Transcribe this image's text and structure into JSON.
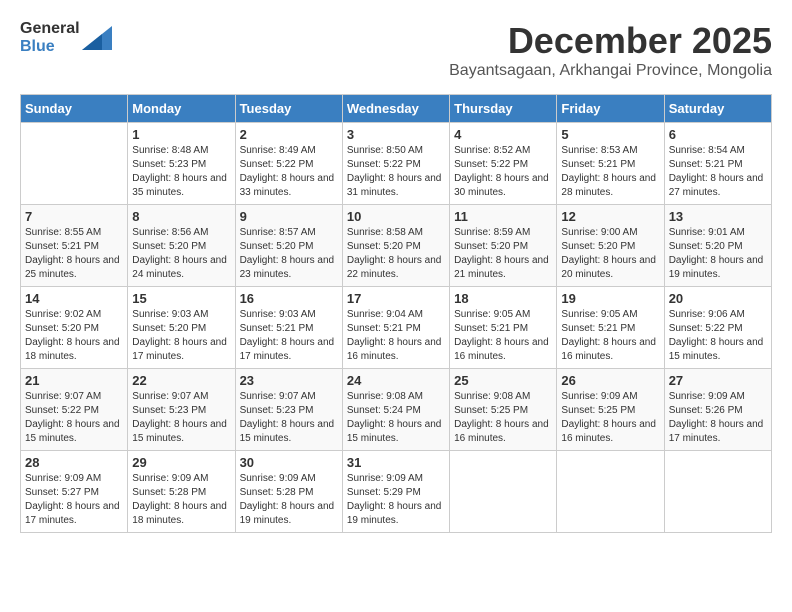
{
  "header": {
    "logo_general": "General",
    "logo_blue": "Blue",
    "month_title": "December 2025",
    "subtitle": "Bayantsagaan, Arkhangai Province, Mongolia"
  },
  "days_of_week": [
    "Sunday",
    "Monday",
    "Tuesday",
    "Wednesday",
    "Thursday",
    "Friday",
    "Saturday"
  ],
  "weeks": [
    [
      {
        "day": "",
        "sunrise": "",
        "sunset": "",
        "daylight": ""
      },
      {
        "day": "1",
        "sunrise": "Sunrise: 8:48 AM",
        "sunset": "Sunset: 5:23 PM",
        "daylight": "Daylight: 8 hours and 35 minutes."
      },
      {
        "day": "2",
        "sunrise": "Sunrise: 8:49 AM",
        "sunset": "Sunset: 5:22 PM",
        "daylight": "Daylight: 8 hours and 33 minutes."
      },
      {
        "day": "3",
        "sunrise": "Sunrise: 8:50 AM",
        "sunset": "Sunset: 5:22 PM",
        "daylight": "Daylight: 8 hours and 31 minutes."
      },
      {
        "day": "4",
        "sunrise": "Sunrise: 8:52 AM",
        "sunset": "Sunset: 5:22 PM",
        "daylight": "Daylight: 8 hours and 30 minutes."
      },
      {
        "day": "5",
        "sunrise": "Sunrise: 8:53 AM",
        "sunset": "Sunset: 5:21 PM",
        "daylight": "Daylight: 8 hours and 28 minutes."
      },
      {
        "day": "6",
        "sunrise": "Sunrise: 8:54 AM",
        "sunset": "Sunset: 5:21 PM",
        "daylight": "Daylight: 8 hours and 27 minutes."
      }
    ],
    [
      {
        "day": "7",
        "sunrise": "Sunrise: 8:55 AM",
        "sunset": "Sunset: 5:21 PM",
        "daylight": "Daylight: 8 hours and 25 minutes."
      },
      {
        "day": "8",
        "sunrise": "Sunrise: 8:56 AM",
        "sunset": "Sunset: 5:20 PM",
        "daylight": "Daylight: 8 hours and 24 minutes."
      },
      {
        "day": "9",
        "sunrise": "Sunrise: 8:57 AM",
        "sunset": "Sunset: 5:20 PM",
        "daylight": "Daylight: 8 hours and 23 minutes."
      },
      {
        "day": "10",
        "sunrise": "Sunrise: 8:58 AM",
        "sunset": "Sunset: 5:20 PM",
        "daylight": "Daylight: 8 hours and 22 minutes."
      },
      {
        "day": "11",
        "sunrise": "Sunrise: 8:59 AM",
        "sunset": "Sunset: 5:20 PM",
        "daylight": "Daylight: 8 hours and 21 minutes."
      },
      {
        "day": "12",
        "sunrise": "Sunrise: 9:00 AM",
        "sunset": "Sunset: 5:20 PM",
        "daylight": "Daylight: 8 hours and 20 minutes."
      },
      {
        "day": "13",
        "sunrise": "Sunrise: 9:01 AM",
        "sunset": "Sunset: 5:20 PM",
        "daylight": "Daylight: 8 hours and 19 minutes."
      }
    ],
    [
      {
        "day": "14",
        "sunrise": "Sunrise: 9:02 AM",
        "sunset": "Sunset: 5:20 PM",
        "daylight": "Daylight: 8 hours and 18 minutes."
      },
      {
        "day": "15",
        "sunrise": "Sunrise: 9:03 AM",
        "sunset": "Sunset: 5:20 PM",
        "daylight": "Daylight: 8 hours and 17 minutes."
      },
      {
        "day": "16",
        "sunrise": "Sunrise: 9:03 AM",
        "sunset": "Sunset: 5:21 PM",
        "daylight": "Daylight: 8 hours and 17 minutes."
      },
      {
        "day": "17",
        "sunrise": "Sunrise: 9:04 AM",
        "sunset": "Sunset: 5:21 PM",
        "daylight": "Daylight: 8 hours and 16 minutes."
      },
      {
        "day": "18",
        "sunrise": "Sunrise: 9:05 AM",
        "sunset": "Sunset: 5:21 PM",
        "daylight": "Daylight: 8 hours and 16 minutes."
      },
      {
        "day": "19",
        "sunrise": "Sunrise: 9:05 AM",
        "sunset": "Sunset: 5:21 PM",
        "daylight": "Daylight: 8 hours and 16 minutes."
      },
      {
        "day": "20",
        "sunrise": "Sunrise: 9:06 AM",
        "sunset": "Sunset: 5:22 PM",
        "daylight": "Daylight: 8 hours and 15 minutes."
      }
    ],
    [
      {
        "day": "21",
        "sunrise": "Sunrise: 9:07 AM",
        "sunset": "Sunset: 5:22 PM",
        "daylight": "Daylight: 8 hours and 15 minutes."
      },
      {
        "day": "22",
        "sunrise": "Sunrise: 9:07 AM",
        "sunset": "Sunset: 5:23 PM",
        "daylight": "Daylight: 8 hours and 15 minutes."
      },
      {
        "day": "23",
        "sunrise": "Sunrise: 9:07 AM",
        "sunset": "Sunset: 5:23 PM",
        "daylight": "Daylight: 8 hours and 15 minutes."
      },
      {
        "day": "24",
        "sunrise": "Sunrise: 9:08 AM",
        "sunset": "Sunset: 5:24 PM",
        "daylight": "Daylight: 8 hours and 15 minutes."
      },
      {
        "day": "25",
        "sunrise": "Sunrise: 9:08 AM",
        "sunset": "Sunset: 5:25 PM",
        "daylight": "Daylight: 8 hours and 16 minutes."
      },
      {
        "day": "26",
        "sunrise": "Sunrise: 9:09 AM",
        "sunset": "Sunset: 5:25 PM",
        "daylight": "Daylight: 8 hours and 16 minutes."
      },
      {
        "day": "27",
        "sunrise": "Sunrise: 9:09 AM",
        "sunset": "Sunset: 5:26 PM",
        "daylight": "Daylight: 8 hours and 17 minutes."
      }
    ],
    [
      {
        "day": "28",
        "sunrise": "Sunrise: 9:09 AM",
        "sunset": "Sunset: 5:27 PM",
        "daylight": "Daylight: 8 hours and 17 minutes."
      },
      {
        "day": "29",
        "sunrise": "Sunrise: 9:09 AM",
        "sunset": "Sunset: 5:28 PM",
        "daylight": "Daylight: 8 hours and 18 minutes."
      },
      {
        "day": "30",
        "sunrise": "Sunrise: 9:09 AM",
        "sunset": "Sunset: 5:28 PM",
        "daylight": "Daylight: 8 hours and 19 minutes."
      },
      {
        "day": "31",
        "sunrise": "Sunrise: 9:09 AM",
        "sunset": "Sunset: 5:29 PM",
        "daylight": "Daylight: 8 hours and 19 minutes."
      },
      {
        "day": "",
        "sunrise": "",
        "sunset": "",
        "daylight": ""
      },
      {
        "day": "",
        "sunrise": "",
        "sunset": "",
        "daylight": ""
      },
      {
        "day": "",
        "sunrise": "",
        "sunset": "",
        "daylight": ""
      }
    ]
  ]
}
